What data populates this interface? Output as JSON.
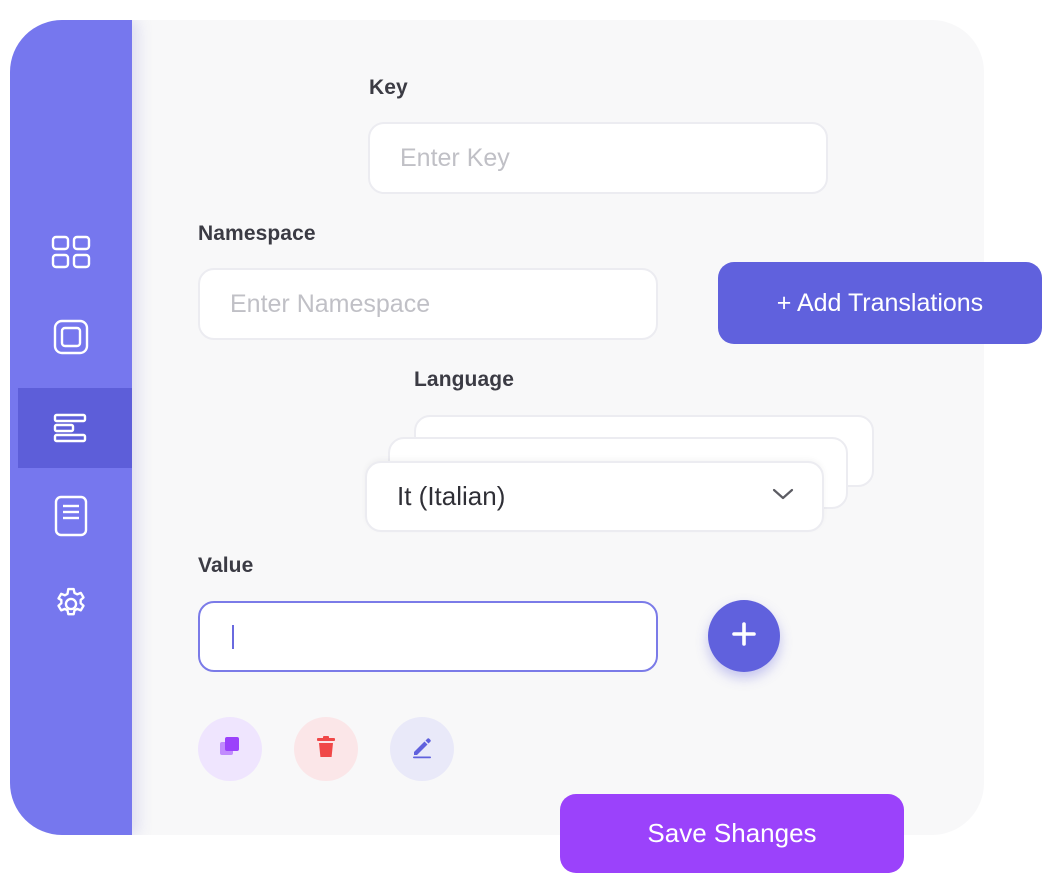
{
  "sidebar": {
    "items": [
      {
        "icon": "grid-icon",
        "active": false
      },
      {
        "icon": "square-icon",
        "active": false
      },
      {
        "icon": "list-icon",
        "active": true
      },
      {
        "icon": "document-icon",
        "active": false
      },
      {
        "icon": "gear-icon",
        "active": false
      }
    ]
  },
  "form": {
    "key": {
      "label": "Key",
      "placeholder": "Enter Key",
      "value": ""
    },
    "namespace": {
      "label": "Namespace",
      "placeholder": "Enter Namespace",
      "value": ""
    },
    "add_translations_label": "+ Add Translations",
    "language": {
      "label": "Language",
      "selected": "It (Italian)"
    },
    "value": {
      "label": "Value",
      "value": ""
    },
    "actions": [
      {
        "icon": "copy-icon",
        "color": "#9b42fb"
      },
      {
        "icon": "trash-icon",
        "color": "#f04848"
      },
      {
        "icon": "pencil-icon",
        "color": "#6061dd"
      }
    ],
    "save_label": "Save Shanges"
  },
  "colors": {
    "sidebar": "#7677ee",
    "sidebar_active": "#5d5ed9",
    "primary": "#6061dd",
    "save": "#9b42fb",
    "background": "#f8f8f9"
  }
}
